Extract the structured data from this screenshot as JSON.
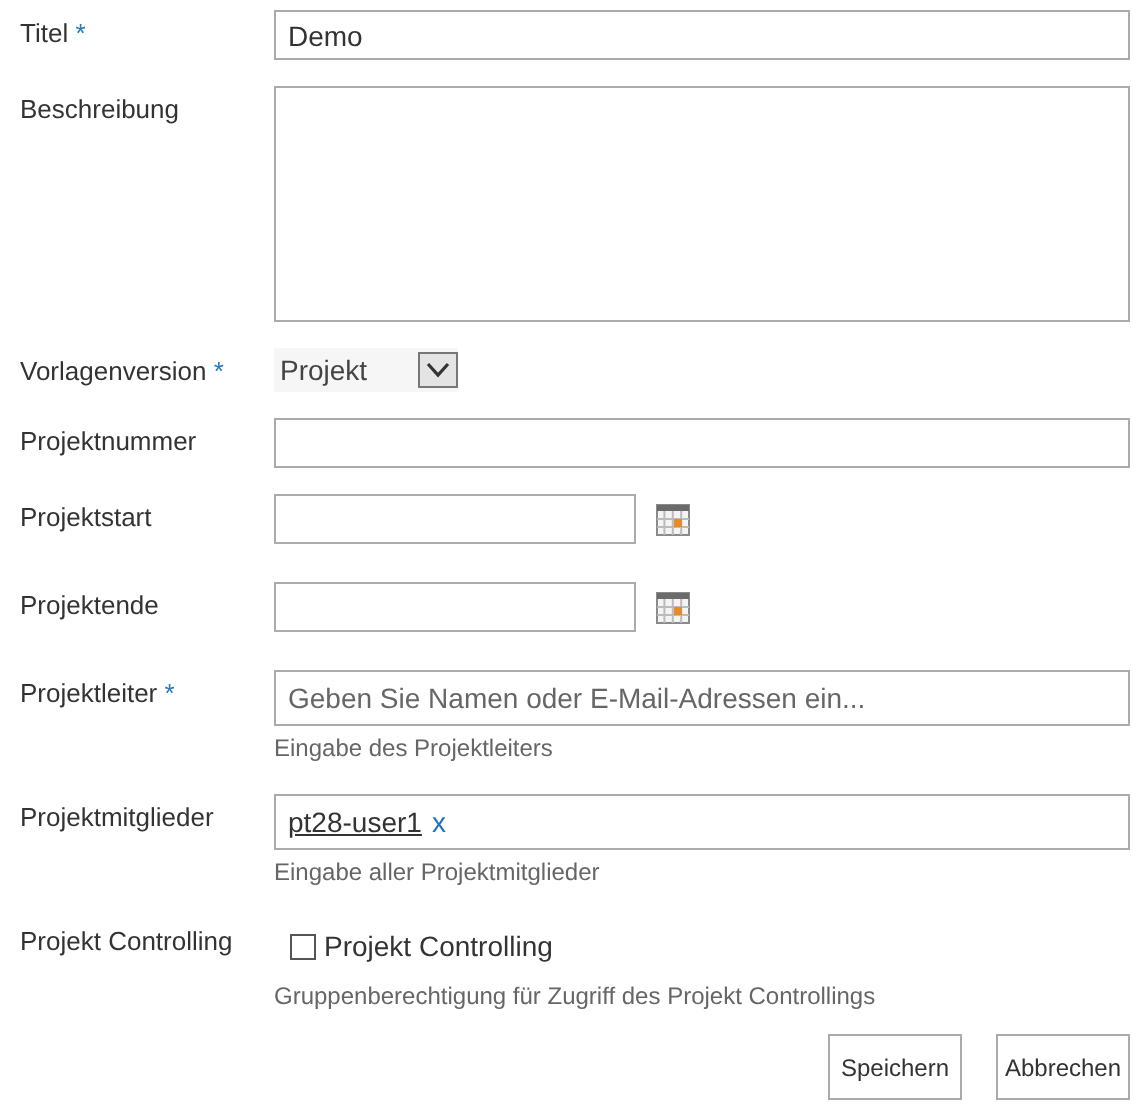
{
  "fields": [
    {
      "kind": "text",
      "label": "Titel",
      "marker": "*",
      "value": "Demo"
    },
    {
      "kind": "textarea",
      "label": "Beschreibung"
    },
    {
      "kind": "select",
      "label": "Vorlagenversion",
      "marker": "*",
      "value": "Projekt"
    },
    {
      "kind": "text",
      "label": "Projektnummer"
    },
    {
      "kind": "date",
      "label": "Projektstart"
    },
    {
      "kind": "date",
      "label": "Projektende"
    },
    {
      "kind": "people",
      "label": "Projektleiter",
      "marker": "*",
      "placeholder": "Geben Sie Namen oder E-Mail-Adressen ein...",
      "hint": "Eingabe des Projektleiters"
    },
    {
      "kind": "people",
      "label": "Projektmitglieder",
      "tokens": [
        {
          "text": "pt28-user1",
          "remove": "x"
        }
      ],
      "hint": "Eingabe aller Projektmitglieder"
    },
    {
      "kind": "checkbox",
      "label": "Projekt Controlling",
      "option": "Projekt Controlling",
      "checked": false,
      "hint": "Gruppenberechtigung für Zugriff des Projekt Controllings"
    }
  ],
  "buttons": [
    "Speichern",
    "Abbrechen"
  ]
}
